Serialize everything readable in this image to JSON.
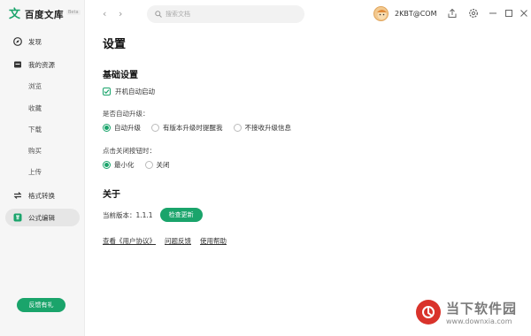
{
  "app": {
    "name": "百度文库",
    "badge": "Beta"
  },
  "sidebar": {
    "items": [
      {
        "label": "发现",
        "icon": "compass-icon"
      },
      {
        "label": "我的资源",
        "icon": "folder-icon"
      }
    ],
    "subitems": [
      "浏览",
      "收藏",
      "下载",
      "购买",
      "上传"
    ],
    "bottom_items": [
      {
        "label": "格式转换",
        "icon": "convert-icon"
      },
      {
        "label": "公式编辑",
        "icon": "formula-icon",
        "active": true
      }
    ],
    "feedback_label": "反馈有礼"
  },
  "topbar": {
    "search_placeholder": "搜索文档",
    "username": "2KBT@COM"
  },
  "settings": {
    "title": "设置",
    "basic_title": "基础设置",
    "autostart_label": "开机自动启动",
    "autostart_checked": true,
    "auto_upgrade_label": "是否自动升级：",
    "upgrade_options": [
      "自动升级",
      "有版本升级时提醒我",
      "不接收升级信息"
    ],
    "upgrade_selected": 0,
    "close_label": "点击关闭按钮时：",
    "close_options": [
      "最小化",
      "关闭"
    ],
    "close_selected": 0,
    "about_title": "关于",
    "version_label": "当前版本：",
    "version": "1.1.1",
    "check_update_label": "检查更新",
    "links": [
      "查看《用户协议》",
      "问题反馈",
      "使用帮助"
    ]
  },
  "watermark": {
    "title": "当下软件园",
    "url": "www.downxia.com"
  },
  "colors": {
    "accent": "#1aa46b",
    "sidebar_bg": "#f6f6f6"
  }
}
